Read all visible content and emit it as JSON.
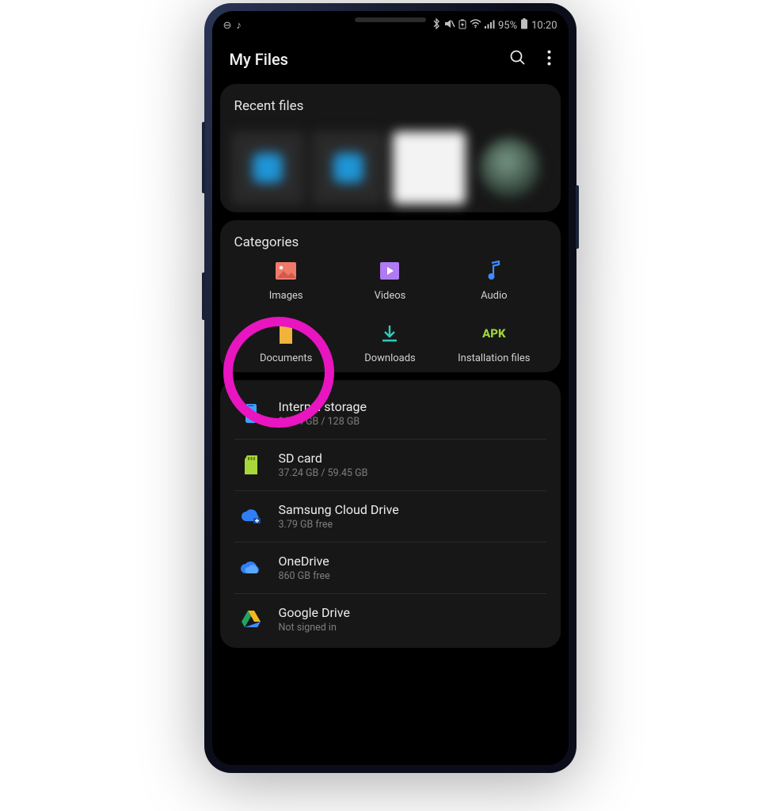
{
  "status": {
    "battery_text": "95%",
    "time": "10:20"
  },
  "header": {
    "title": "My Files"
  },
  "recent": {
    "title": "Recent files"
  },
  "categories": {
    "title": "Categories",
    "items": [
      {
        "label": "Images",
        "icon": "image-icon",
        "color": "#f07a6a"
      },
      {
        "label": "Videos",
        "icon": "video-icon",
        "color": "#b07af2"
      },
      {
        "label": "Audio",
        "icon": "audio-icon",
        "color": "#3f8cff"
      },
      {
        "label": "Documents",
        "icon": "document-icon",
        "color": "#f0b33c"
      },
      {
        "label": "Downloads",
        "icon": "download-icon",
        "color": "#33c9b8"
      },
      {
        "label": "Installation files",
        "icon": "apk-icon",
        "color": "#9fd63a"
      }
    ],
    "highlighted_index": 3
  },
  "storage": {
    "items": [
      {
        "name": "Internal storage",
        "sub": "96.14 GB / 128 GB",
        "icon": "phone-storage-icon",
        "color": "#3fa2ff"
      },
      {
        "name": "SD card",
        "sub": "37.24 GB / 59.45 GB",
        "icon": "sdcard-icon",
        "color": "#a9d63a"
      },
      {
        "name": "Samsung Cloud Drive",
        "sub": "3.79 GB free",
        "icon": "samsung-cloud-icon",
        "color": "#2f7ef5"
      },
      {
        "name": "OneDrive",
        "sub": "860 GB free",
        "icon": "onedrive-icon",
        "color": "#2f7ef5"
      },
      {
        "name": "Google Drive",
        "sub": "Not signed in",
        "icon": "googledrive-icon",
        "color": "#f5b61e"
      }
    ]
  }
}
